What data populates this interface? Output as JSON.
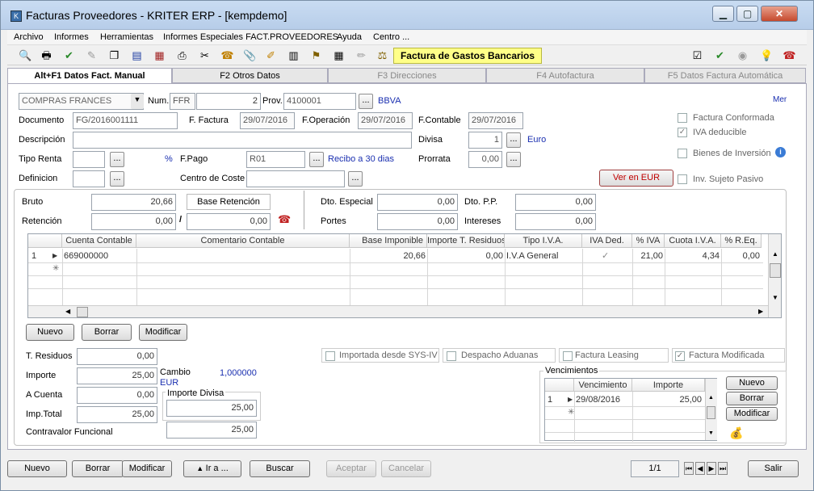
{
  "window": {
    "title": "Facturas Proveedores  - KRITER ERP - [kempdemo]"
  },
  "menu": [
    "Archivo",
    "Informes",
    "Herramientas",
    "Informes Especiales FACT.PROVEEDORES",
    "Ayuda",
    "Centro ..."
  ],
  "toolbar": {
    "doc_type": "Factura de Gastos Bancarios"
  },
  "tabs": [
    "Alt+F1 Datos Fact. Manual",
    "F2 Otros Datos",
    "F3 Direcciones",
    "F4 Autofactura",
    "F5 Datos Factura Automática"
  ],
  "header": {
    "serie": "COMPRAS FRANCES",
    "num_label": "Num.",
    "num_prefix": "FFR",
    "num_value": "2",
    "prov_label": "Prov.",
    "prov_code": "4100001",
    "prov_name": "BBVA",
    "mer": "Mer",
    "documento_label": "Documento",
    "documento": "FG/2016001111",
    "f_factura_label": "F. Factura",
    "f_factura": "29/07/2016",
    "f_operacion_label": "F.Operación",
    "f_operacion": "29/07/2016",
    "f_contable_label": "F.Contable",
    "f_contable": "29/07/2016",
    "descripcion_label": "Descripción",
    "descripcion": "",
    "divisa_label": "Divisa",
    "divisa": "1",
    "divisa_name": "Euro",
    "tipo_renta_label": "Tipo Renta",
    "pct": "%",
    "f_pago_label": "F.Pago",
    "f_pago": "R01",
    "f_pago_desc": "Recibo a 30 dias",
    "prorrata_label": "Prorrata",
    "prorrata": "0,00",
    "definicion_label": "Definicion",
    "centro_coste_label": "Centro de Coste",
    "ver_en_eur": "Ver en EUR"
  },
  "checks": {
    "factura_conformada": "Factura Conformada",
    "iva_deducible": "IVA deducible",
    "bienes_inversion": "Bienes de Inversión",
    "inv_sujeto_pasivo": "Inv. Sujeto Pasivo"
  },
  "totals": {
    "bruto_label": "Bruto",
    "bruto": "20,66",
    "base_retencion_label": "Base Retención",
    "retencion_label": "Retención",
    "retencion": "0,00",
    "retencion_amt": "0,00",
    "dto_especial_label": "Dto. Especial",
    "dto_especial": "0,00",
    "dto_pp_label": "Dto. P.P.",
    "dto_pp": "0,00",
    "portes_label": "Portes",
    "portes": "0,00",
    "intereses_label": "Intereses",
    "intereses": "0,00"
  },
  "grid": {
    "columns": [
      "Cuenta Contable",
      "Comentario Contable",
      "Base Imponible",
      "Importe T. Residuos",
      "Tipo I.V.A.",
      "IVA Ded.",
      "% IVA",
      "Cuota I.V.A.",
      "% R.Eq."
    ],
    "rows": [
      {
        "num": "1",
        "cuenta": "669000000",
        "comentario": "",
        "base": "20,66",
        "residuos": "0,00",
        "tipo_iva": "I.V.A General",
        "iva_ded": "✓",
        "pct_iva": "21,00",
        "cuota": "4,34",
        "req": "0,00"
      }
    ]
  },
  "grid_buttons": {
    "nuevo": "Nuevo",
    "borrar": "Borrar",
    "modificar": "Modificar"
  },
  "bottom": {
    "t_residuos_label": "T. Residuos",
    "t_residuos": "0,00",
    "importe_label": "Importe",
    "importe": "25,00",
    "cambio_label": "Cambio",
    "cambio": "1,000000",
    "cambio_cur": "EUR",
    "a_cuenta_label": "A Cuenta",
    "a_cuenta": "0,00",
    "importe_divisa_label": "Importe Divisa",
    "importe_divisa": "25,00",
    "imp_total_label": "Imp.Total",
    "imp_total": "25,00",
    "contravalor_label": "Contravalor Funcional",
    "contravalor": "25,00",
    "importada_sys": "Importada desde SYS-IV",
    "despacho_aduanas": "Despacho Aduanas",
    "factura_leasing": "Factura Leasing",
    "factura_modificada": "Factura Modificada"
  },
  "vencimientos": {
    "title": "Vencimientos",
    "columns": [
      "Vencimiento",
      "Importe"
    ],
    "rows": [
      {
        "num": "1",
        "fecha": "29/08/2016",
        "importe": "25,00"
      }
    ],
    "nuevo": "Nuevo",
    "borrar": "Borrar",
    "modificar": "Modificar"
  },
  "footer": {
    "nuevo": "Nuevo",
    "borrar": "Borrar",
    "modificar": "Modificar",
    "ira": "Ir a ...",
    "buscar": "Buscar",
    "aceptar": "Aceptar",
    "cancelar": "Cancelar",
    "page": "1/1",
    "salir": "Salir"
  }
}
